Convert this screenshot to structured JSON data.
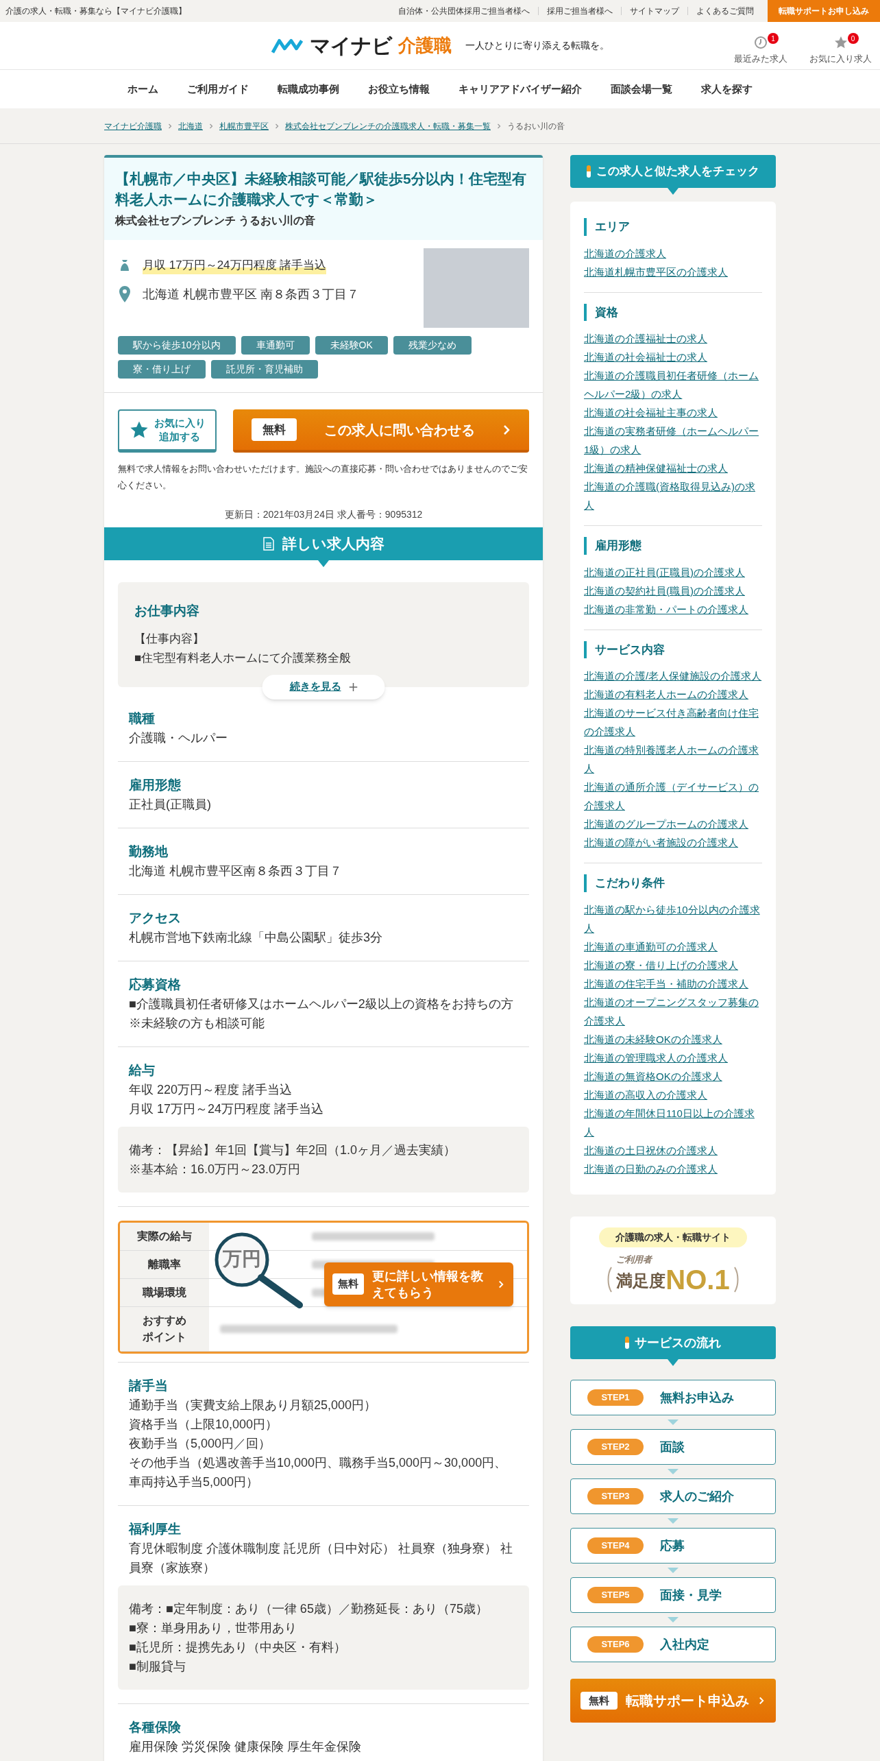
{
  "top_bar": {
    "tagline": "介護の求人・転職・募集なら【マイナビ介護職】",
    "links": [
      "自治体・公共団体採用ご担当者様へ",
      "採用ご担当者様へ",
      "サイトマップ",
      "よくあるご質問"
    ],
    "cta": "転職サポートお申し込み"
  },
  "header": {
    "logo_main": "マイナビ",
    "logo_sub": "介護職",
    "catchphrase": "一人ひとりに寄り添える転職を。",
    "icons": [
      {
        "kind": "history",
        "label": "最近みた求人",
        "count": "1"
      },
      {
        "kind": "favorite",
        "label": "お気に入り求人",
        "count": "0"
      }
    ]
  },
  "nav": [
    "ホーム",
    "ご利用ガイド",
    "転職成功事例",
    "お役立ち情報",
    "キャリアアドバイザー紹介",
    "面談会場一覧",
    "求人を探す"
  ],
  "breadcrumb": [
    {
      "label": "マイナビ介護職",
      "link": true
    },
    {
      "label": "北海道",
      "link": true
    },
    {
      "label": "札幌市豊平区",
      "link": true
    },
    {
      "label": "株式会社セブンブレンチの介護職求人・転職・募集一覧",
      "link": true
    },
    {
      "label": "うるおい川の音",
      "link": false
    }
  ],
  "job": {
    "title": "【札幌市／中央区】未経験相談可能／駅徒歩5分以内！住宅型有料老人ホームに介護職求人です＜常勤＞",
    "company": "株式会社セブンブレンチ うるおい川の音",
    "salary": "月収 17万円～24万円程度 諸手当込",
    "address": "北海道 札幌市豊平区 南８条西３丁目７",
    "tags": [
      "駅から徒歩10分以内",
      "車通勤可",
      "未経験OK",
      "残業少なめ",
      "寮・借り上げ",
      "託児所・育児補助"
    ],
    "favorite_button": "お気に入り追加する",
    "contact_badge": "無料",
    "contact_button": "この求人に問い合わせる",
    "note": "無料で求人情報をお問い合わせいただけます。施設への直接応募・問い合わせではありませんのでご安心ください。",
    "meta": "更新日：2021年03月24日 求人番号：9095312",
    "section_title": "詳しい求人内容",
    "work": {
      "title": "お仕事内容",
      "lines": [
        "【仕事内容】",
        "■住宅型有料老人ホームにて介護業務全般"
      ],
      "more": "続きを見る"
    },
    "fields": [
      {
        "label": "職種",
        "lines": [
          "介護職・ヘルパー"
        ]
      },
      {
        "label": "雇用形態",
        "lines": [
          "正社員(正職員)"
        ]
      },
      {
        "label": "勤務地",
        "lines": [
          "北海道 札幌市豊平区南８条西３丁目７"
        ]
      },
      {
        "label": "アクセス",
        "lines": [
          "札幌市営地下鉄南北線「中島公園駅」徒歩3分"
        ]
      },
      {
        "label": "応募資格",
        "lines": [
          "■介護職員初任者研修又はホームヘルパー2級以上の資格をお持ちの方",
          "※未経験の方も相談可能"
        ]
      },
      {
        "label": "給与",
        "lines": [
          "年収 220万円～程度 諸手当込",
          "月収 17万円～24万円程度 諸手当込"
        ],
        "notes": [
          "備考：【昇給】年1回【賞与】年2回（1.0ヶ月／過去実績）",
          "※基本給：16.0万円～23.0万円"
        ]
      }
    ],
    "teaser": {
      "rows": [
        [
          "実際の給与"
        ],
        [
          "離職率"
        ],
        [
          "職場環境"
        ],
        [
          "おすすめ",
          "ポイント"
        ]
      ],
      "magnifier_text": "万円",
      "badge": "無料",
      "button": "更に詳しい情報を教えてもらう"
    },
    "fields_after": [
      {
        "label": "諸手当",
        "lines": [
          "通勤手当（実費支給上限あり月額25,000円）",
          "資格手当（上限10,000円）",
          "夜勤手当（5,000円／回）",
          "その他手当（処遇改善手当10,000円、職務手当5,000円～30,000円、車両持込手当5,000円）"
        ]
      },
      {
        "label": "福利厚生",
        "lines": [
          "育児休暇制度 介護休職制度 託児所（日中対応） 社員寮（独身寮） 社員寮（家族寮）"
        ],
        "notes": [
          "備考：■定年制度：あり（一律 65歳）／勤務延長：あり（75歳）",
          "■寮：単身用あり，世帯用あり",
          "■託児所：提携先あり（中央区・有料）",
          "■制服貸与"
        ]
      },
      {
        "label": "各種保険",
        "lines": [
          "雇用保険 労災保険 健康保険 厚生年金保険"
        ]
      }
    ]
  },
  "sidebar": {
    "similar_title": "この求人と似た求人をチェック",
    "groups": [
      {
        "heading": "エリア",
        "links": [
          "北海道の介護求人",
          "北海道札幌市豊平区の介護求人"
        ]
      },
      {
        "heading": "資格",
        "links": [
          "北海道の介護福祉士の求人",
          "北海道の社会福祉士の求人",
          "北海道の介護職員初任者研修（ホームヘルパー2級）の求人",
          "北海道の社会福祉主事の求人",
          "北海道の実務者研修（ホームヘルパー1級）の求人",
          "北海道の精神保健福祉士の求人",
          "北海道の介護職(資格取得見込み)の求人"
        ]
      },
      {
        "heading": "雇用形態",
        "links": [
          "北海道の正社員(正職員)の介護求人",
          "北海道の契約社員(職員)の介護求人",
          "北海道の非常勤・パートの介護求人"
        ]
      },
      {
        "heading": "サービス内容",
        "links": [
          "北海道の介護/老人保健施設の介護求人",
          "北海道の有料老人ホームの介護求人",
          "北海道のサービス付き高齢者向け住宅の介護求人",
          "北海道の特別養護老人ホームの介護求人",
          "北海道の通所介護（デイサービス）の介護求人",
          "北海道のグループホームの介護求人",
          "北海道の障がい者施設の介護求人"
        ]
      },
      {
        "heading": "こだわり条件",
        "links": [
          "北海道の駅から徒歩10分以内の介護求人",
          "北海道の車通勤可の介護求人",
          "北海道の寮・借り上げの介護求人",
          "北海道の住宅手当・補助の介護求人",
          "北海道のオープニングスタッフ募集の介護求人",
          "北海道の未経験OKの介護求人",
          "北海道の管理職求人の介護求人",
          "北海道の無資格OKの介護求人",
          "北海道の高収入の介護求人",
          "北海道の年間休日110日以上の介護求人",
          "北海道の土日祝休の介護求人",
          "北海道の日勤のみの介護求人"
        ]
      }
    ],
    "award": {
      "pill": "介護職の求人・転職サイト",
      "small": "ご利用者",
      "main_left": "満足度",
      "main_right": "NO.1"
    },
    "flow_title": "サービスの流れ",
    "steps": [
      {
        "step": "STEP1",
        "label": "無料お申込み"
      },
      {
        "step": "STEP2",
        "label": "面談"
      },
      {
        "step": "STEP3",
        "label": "求人のご紹介"
      },
      {
        "step": "STEP4",
        "label": "応募"
      },
      {
        "step": "STEP5",
        "label": "面接・見学"
      },
      {
        "step": "STEP6",
        "label": "入社内定"
      }
    ],
    "cta_badge": "無料",
    "cta": "転職サポート申込み"
  }
}
